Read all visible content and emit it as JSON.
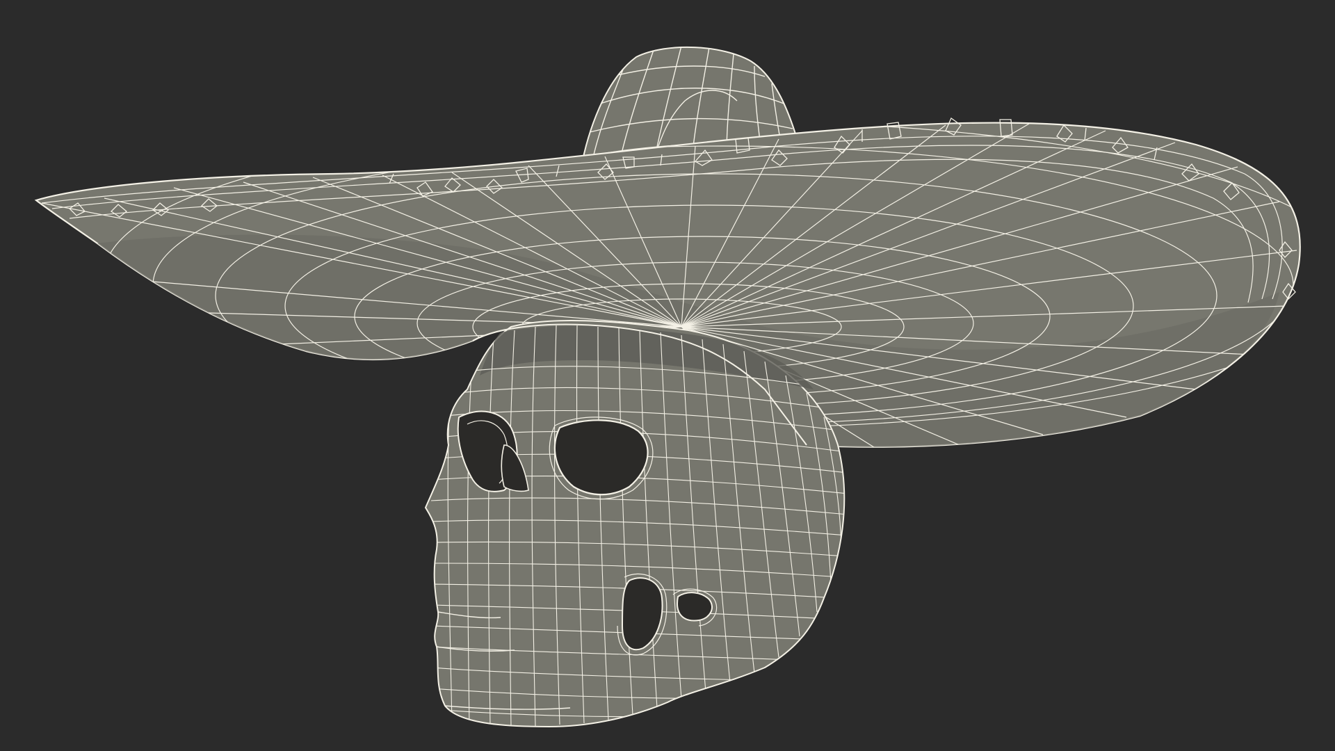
{
  "scene": {
    "description_colors": {
      "background": "#2b2b2b",
      "surface": "#76766d",
      "surface_shadow": "#5e5e57",
      "surface_dark": "#4a4a45",
      "hole": "#2a2a28",
      "wire": "#f4f1e6"
    },
    "objects": [
      {
        "name": "sombrero",
        "icon": "hat-wireframe-icon"
      },
      {
        "name": "skull",
        "icon": "skull-wireframe-icon"
      }
    ]
  }
}
